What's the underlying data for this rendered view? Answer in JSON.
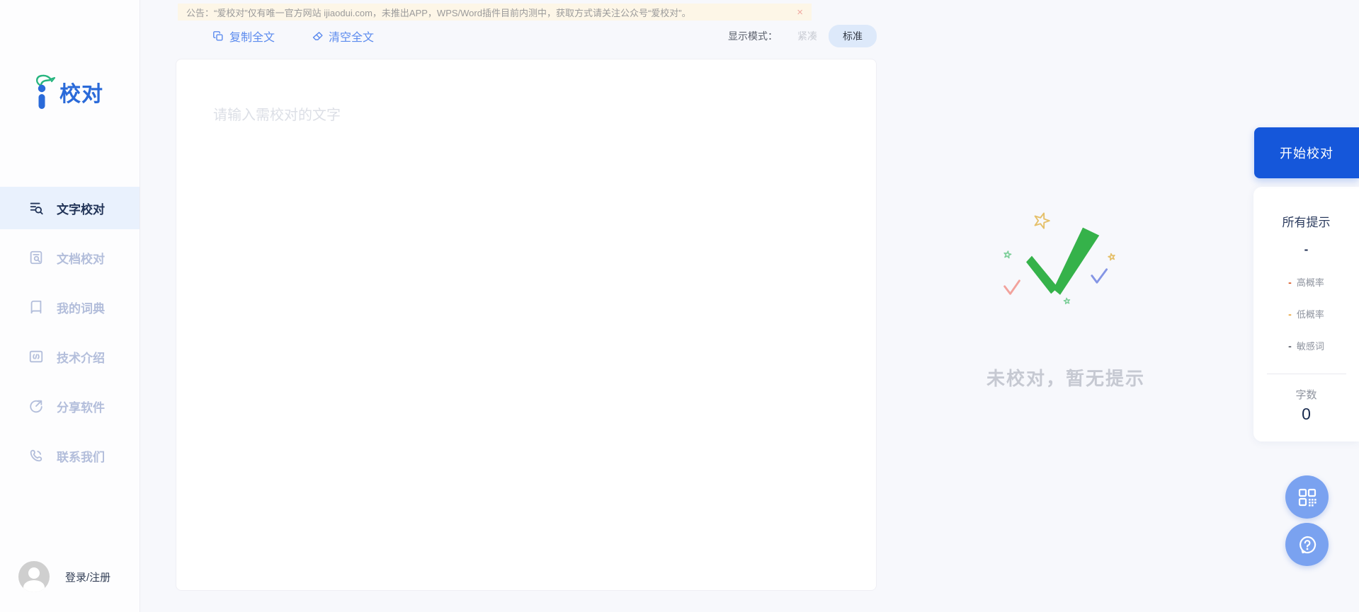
{
  "logo": {
    "text": "校对"
  },
  "sidebar": {
    "items": [
      {
        "label": "文字校对",
        "icon": "text-proofread-icon",
        "active": true
      },
      {
        "label": "文档校对",
        "icon": "doc-proofread-icon",
        "active": false
      },
      {
        "label": "我的词典",
        "icon": "dictionary-icon",
        "active": false
      },
      {
        "label": "技术介绍",
        "icon": "tech-intro-icon",
        "active": false
      },
      {
        "label": "分享软件",
        "icon": "share-icon",
        "active": false
      },
      {
        "label": "联系我们",
        "icon": "contact-icon",
        "active": false
      }
    ],
    "login_label": "登录/注册"
  },
  "announcement": {
    "text": "公告：“爱校对”仅有唯一官方网站 ijiaodui.com，未推出APP，WPS/Word插件目前内测中，获取方式请关注公众号“爱校对”。",
    "close_icon": "×"
  },
  "toolbar": {
    "copy_label": "复制全文",
    "clear_label": "清空全文",
    "display_mode_label": "显示模式：",
    "mode_compact": "紧凑",
    "mode_standard": "标准"
  },
  "editor": {
    "placeholder": "请输入需校对的文字"
  },
  "result_panel": {
    "empty_text": "未校对，暂无提示"
  },
  "action": {
    "start_label": "开始校对"
  },
  "stats": {
    "all_hints_label": "所有提示",
    "all_hints_value": "-",
    "legend": [
      {
        "dash": "-",
        "label": "高概率",
        "color": "#d9541e"
      },
      {
        "dash": "-",
        "label": "低概率",
        "color": "#e8a53c"
      },
      {
        "dash": "-",
        "label": "敏感词",
        "color": "#555a66"
      }
    ],
    "word_count_label": "字数",
    "word_count_value": "0"
  },
  "colors": {
    "primary_blue": "#1557da",
    "link_blue": "#5c8bee",
    "logo_blue": "#2a6ad9",
    "logo_green": "#27b57f",
    "nav_active_bg": "#e9f1fd",
    "nav_inactive": "#b3bedb",
    "announcement_bg": "#fdf6e7",
    "page_bg": "#f7f8fc",
    "check_green": "#35b24a",
    "check_salmon": "#f2a29c",
    "check_blue": "#8495e5",
    "star_yellow": "#e5c06a",
    "float_button_blue": "#7aa2f0"
  }
}
